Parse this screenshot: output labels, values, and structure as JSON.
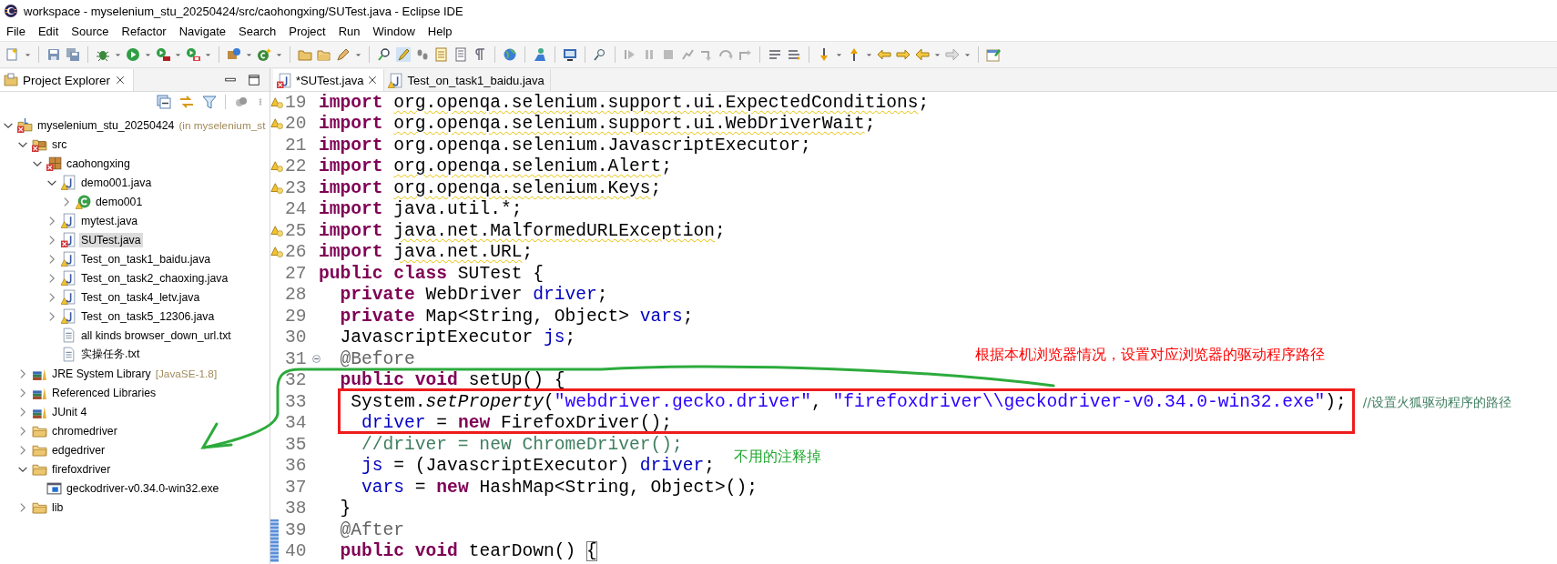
{
  "window": {
    "title": "workspace - myselenium_stu_20250424/src/caohongxing/SUTest.java - Eclipse IDE"
  },
  "menu": [
    {
      "label": "File"
    },
    {
      "label": "Edit"
    },
    {
      "label": "Source"
    },
    {
      "label": "Refactor"
    },
    {
      "label": "Navigate"
    },
    {
      "label": "Search"
    },
    {
      "label": "Project"
    },
    {
      "label": "Run"
    },
    {
      "label": "Window"
    },
    {
      "label": "Help"
    }
  ],
  "explorer": {
    "title": "Project Explorer",
    "tree": [
      {
        "label": "myselenium_stu_20250424",
        "decoration": "(in myselenium_st",
        "kind": "project",
        "error": true,
        "warning": false,
        "expanded": true,
        "selected": false,
        "children": [
          {
            "label": "src",
            "kind": "source-folder",
            "error": true,
            "warning": false,
            "expanded": true,
            "selected": false,
            "children": [
              {
                "label": "caohongxing",
                "kind": "package",
                "error": true,
                "warning": false,
                "expanded": true,
                "selected": false,
                "children": [
                  {
                    "label": "demo001.java",
                    "kind": "java",
                    "error": false,
                    "warning": true,
                    "expanded": true,
                    "selected": false,
                    "children": [
                      {
                        "label": "demo001",
                        "kind": "class",
                        "error": false,
                        "warning": true,
                        "expanded": false,
                        "selected": false
                      }
                    ]
                  },
                  {
                    "label": "mytest.java",
                    "kind": "java",
                    "error": false,
                    "warning": true,
                    "expanded": false,
                    "selected": false
                  },
                  {
                    "label": "SUTest.java",
                    "kind": "java",
                    "error": true,
                    "warning": false,
                    "expanded": false,
                    "selected": true
                  },
                  {
                    "label": "Test_on_task1_baidu.java",
                    "kind": "java",
                    "error": false,
                    "warning": true,
                    "expanded": false,
                    "selected": false
                  },
                  {
                    "label": "Test_on_task2_chaoxing.java",
                    "kind": "java",
                    "error": false,
                    "warning": true,
                    "expanded": false,
                    "selected": false
                  },
                  {
                    "label": "Test_on_task4_letv.java",
                    "kind": "java",
                    "error": false,
                    "warning": true,
                    "expanded": false,
                    "selected": false
                  },
                  {
                    "label": "Test_on_task5_12306.java",
                    "kind": "java",
                    "error": false,
                    "warning": true,
                    "expanded": false,
                    "selected": false
                  },
                  {
                    "label": "all kinds browser_down_url.txt",
                    "kind": "text",
                    "error": false,
                    "warning": false,
                    "selected": false
                  },
                  {
                    "label": "实操任务.txt",
                    "kind": "text",
                    "error": false,
                    "warning": false,
                    "selected": false
                  }
                ]
              }
            ]
          },
          {
            "label": "JRE System Library",
            "decoration": "[JavaSE-1.8]",
            "kind": "library",
            "error": false,
            "warning": false,
            "expanded": false,
            "selected": false
          },
          {
            "label": "Referenced Libraries",
            "kind": "library",
            "error": false,
            "warning": false,
            "expanded": false,
            "selected": false
          },
          {
            "label": "JUnit 4",
            "kind": "library",
            "error": false,
            "warning": false,
            "expanded": false,
            "selected": false
          },
          {
            "label": "chromedriver",
            "kind": "folder",
            "error": false,
            "warning": false,
            "expanded": false,
            "selected": false
          },
          {
            "label": "edgedriver",
            "kind": "folder",
            "error": false,
            "warning": false,
            "expanded": false,
            "selected": false
          },
          {
            "label": "firefoxdriver",
            "kind": "folder",
            "error": false,
            "warning": false,
            "expanded": true,
            "selected": false,
            "children": [
              {
                "label": "geckodriver-v0.34.0-win32.exe",
                "kind": "executable",
                "error": false,
                "warning": false,
                "selected": false
              }
            ]
          },
          {
            "label": "lib",
            "kind": "folder",
            "error": false,
            "warning": false,
            "expanded": false,
            "selected": false
          }
        ]
      }
    ]
  },
  "editor": {
    "tabs": [
      {
        "label": "*SUTest.java",
        "error": true,
        "warning": false,
        "selected": true,
        "closable": true
      },
      {
        "label": "Test_on_task1_baidu.java",
        "error": false,
        "warning": true,
        "selected": false,
        "closable": false
      }
    ],
    "lines": [
      {
        "number": "19",
        "warning": true,
        "collapsible": false,
        "changed": false,
        "tokens": [
          {
            "kind": "keyword",
            "text": "import "
          },
          {
            "kind": "warned",
            "text": "org.openqa.selenium.support.ui.ExpectedConditions"
          },
          {
            "kind": "plain",
            "text": ";"
          }
        ]
      },
      {
        "number": "20",
        "warning": true,
        "collapsible": false,
        "changed": false,
        "tokens": [
          {
            "kind": "keyword",
            "text": "import "
          },
          {
            "kind": "warned",
            "text": "org.openqa.selenium.support.ui.WebDriverWait"
          },
          {
            "kind": "plain",
            "text": ";"
          }
        ]
      },
      {
        "number": "21",
        "warning": false,
        "collapsible": false,
        "changed": false,
        "tokens": [
          {
            "kind": "keyword",
            "text": "import "
          },
          {
            "kind": "plain",
            "text": "org.openqa.selenium.JavascriptExecutor;"
          }
        ]
      },
      {
        "number": "22",
        "warning": true,
        "collapsible": false,
        "changed": false,
        "tokens": [
          {
            "kind": "keyword",
            "text": "import "
          },
          {
            "kind": "warned",
            "text": "org.openqa.selenium.Alert"
          },
          {
            "kind": "plain",
            "text": ";"
          }
        ]
      },
      {
        "number": "23",
        "warning": true,
        "collapsible": false,
        "changed": false,
        "tokens": [
          {
            "kind": "keyword",
            "text": "import "
          },
          {
            "kind": "warned",
            "text": "org.openqa.selenium.Keys"
          },
          {
            "kind": "plain",
            "text": ";"
          }
        ]
      },
      {
        "number": "24",
        "warning": false,
        "collapsible": false,
        "changed": false,
        "tokens": [
          {
            "kind": "keyword",
            "text": "import "
          },
          {
            "kind": "plain",
            "text": "java.util.*;"
          }
        ]
      },
      {
        "number": "25",
        "warning": true,
        "collapsible": false,
        "changed": false,
        "tokens": [
          {
            "kind": "keyword",
            "text": "import "
          },
          {
            "kind": "warned",
            "text": "java.net.MalformedURLException"
          },
          {
            "kind": "plain",
            "text": ";"
          }
        ]
      },
      {
        "number": "26",
        "warning": true,
        "collapsible": false,
        "changed": false,
        "tokens": [
          {
            "kind": "keyword",
            "text": "import "
          },
          {
            "kind": "warned",
            "text": "java.net.URL"
          },
          {
            "kind": "plain",
            "text": ";"
          }
        ]
      },
      {
        "number": "27",
        "warning": false,
        "collapsible": false,
        "changed": false,
        "tokens": [
          {
            "kind": "keyword",
            "text": "public class "
          },
          {
            "kind": "plain",
            "text": "SUTest {"
          }
        ]
      },
      {
        "number": "28",
        "warning": false,
        "collapsible": false,
        "changed": false,
        "tokens": [
          {
            "kind": "keyword",
            "text": "  private "
          },
          {
            "kind": "plain",
            "text": "WebDriver "
          },
          {
            "kind": "field",
            "text": "driver"
          },
          {
            "kind": "plain",
            "text": ";"
          }
        ]
      },
      {
        "number": "29",
        "warning": false,
        "collapsible": false,
        "changed": false,
        "tokens": [
          {
            "kind": "keyword",
            "text": "  private "
          },
          {
            "kind": "plain",
            "text": "Map<String, Object> "
          },
          {
            "kind": "field",
            "text": "vars"
          },
          {
            "kind": "plain",
            "text": ";"
          }
        ]
      },
      {
        "number": "30",
        "warning": false,
        "collapsible": false,
        "changed": false,
        "tokens": [
          {
            "kind": "plain",
            "text": "  JavascriptExecutor "
          },
          {
            "kind": "field",
            "text": "js"
          },
          {
            "kind": "plain",
            "text": ";"
          }
        ]
      },
      {
        "number": "31",
        "warning": false,
        "collapsible": true,
        "changed": false,
        "tokens": [
          {
            "kind": "annotation",
            "text": "  @Before"
          }
        ]
      },
      {
        "number": "32",
        "warning": false,
        "collapsible": false,
        "changed": false,
        "tokens": [
          {
            "kind": "keyword",
            "text": "  public void "
          },
          {
            "kind": "plain",
            "text": "setUp() {"
          }
        ]
      },
      {
        "number": "33",
        "warning": false,
        "collapsible": false,
        "changed": false,
        "tokens": [
          {
            "kind": "plain",
            "text": "   System."
          },
          {
            "kind": "method",
            "text": "setProperty"
          },
          {
            "kind": "plain",
            "text": "("
          },
          {
            "kind": "string",
            "text": "\"webdriver.gecko.driver\""
          },
          {
            "kind": "plain",
            "text": ", "
          },
          {
            "kind": "string",
            "text": "\"firefoxdriver\\\\geckodriver-v0.34.0-win32.exe\""
          },
          {
            "kind": "plain",
            "text": ");"
          },
          {
            "kind": "note",
            "text": "//设置火狐驱动程序的路径"
          }
        ]
      },
      {
        "number": "34",
        "warning": false,
        "collapsible": false,
        "changed": false,
        "tokens": [
          {
            "kind": "field",
            "text": "    driver"
          },
          {
            "kind": "plain",
            "text": " = "
          },
          {
            "kind": "keyword",
            "text": "new "
          },
          {
            "kind": "plain",
            "text": "FirefoxDriver();"
          }
        ]
      },
      {
        "number": "35",
        "warning": false,
        "collapsible": false,
        "changed": false,
        "tokens": [
          {
            "kind": "comment",
            "text": "    //driver = new ChromeDriver();"
          }
        ]
      },
      {
        "number": "36",
        "warning": false,
        "collapsible": false,
        "changed": false,
        "tokens": [
          {
            "kind": "field",
            "text": "    js"
          },
          {
            "kind": "plain",
            "text": " = (JavascriptExecutor) "
          },
          {
            "kind": "field",
            "text": "driver"
          },
          {
            "kind": "plain",
            "text": ";"
          }
        ]
      },
      {
        "number": "37",
        "warning": false,
        "collapsible": false,
        "changed": false,
        "tokens": [
          {
            "kind": "field",
            "text": "    vars"
          },
          {
            "kind": "plain",
            "text": " = "
          },
          {
            "kind": "keyword",
            "text": "new "
          },
          {
            "kind": "plain",
            "text": "HashMap<String, Object>();"
          }
        ]
      },
      {
        "number": "38",
        "warning": false,
        "collapsible": false,
        "changed": false,
        "tokens": [
          {
            "kind": "plain",
            "text": "  }"
          }
        ]
      },
      {
        "number": "39",
        "warning": false,
        "collapsible": false,
        "changed": true,
        "tokens": [
          {
            "kind": "annotation",
            "text": "  @After"
          }
        ]
      },
      {
        "number": "40",
        "warning": false,
        "collapsible": false,
        "changed": true,
        "tokens": [
          {
            "kind": "keyword",
            "text": "  public void "
          },
          {
            "kind": "plain",
            "text": "tearDown() "
          },
          {
            "kind": "bracket",
            "text": "{"
          }
        ]
      }
    ]
  },
  "annotations": [
    {
      "text": "根据本机浏览器情况，设置对应浏览器的驱动程序路径",
      "color": "#ff0000"
    },
    {
      "text": "不用的注释掉",
      "color": "#22a832"
    }
  ]
}
